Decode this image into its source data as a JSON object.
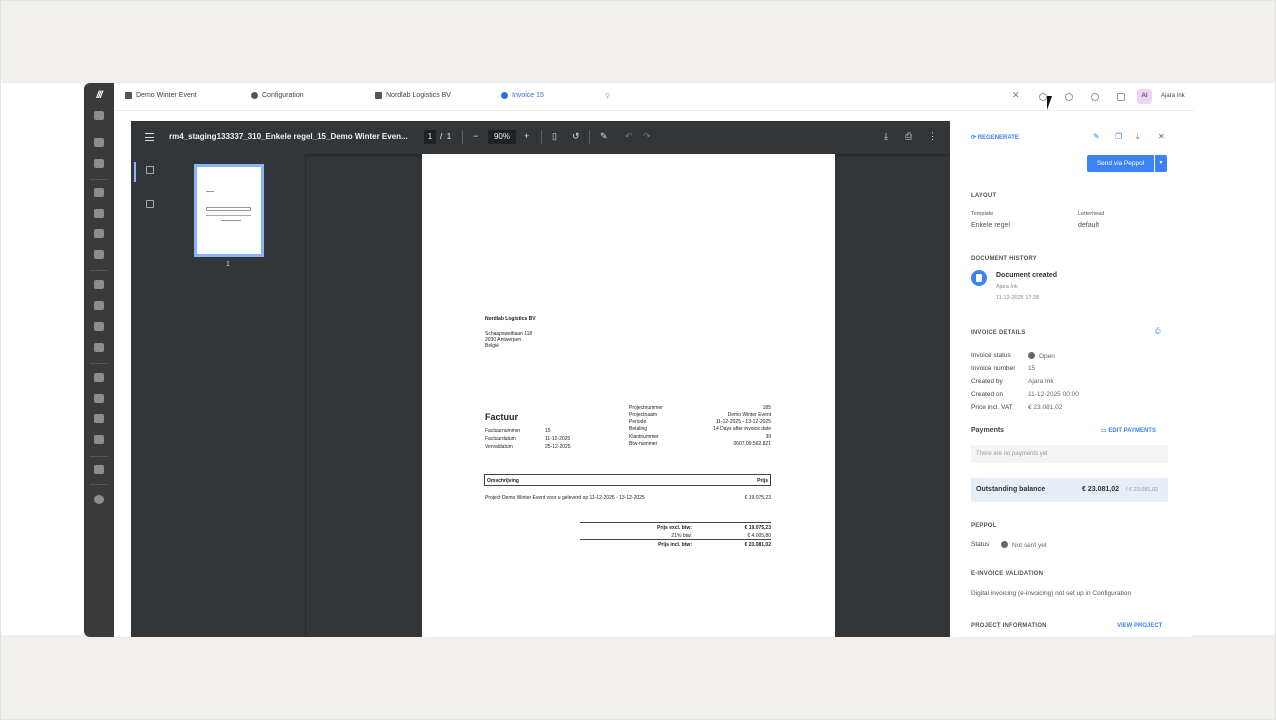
{
  "tabs": [
    {
      "label": "Demo Winter Event",
      "icon": "calendar-icon"
    },
    {
      "label": "Configuration",
      "icon": "gear-icon"
    },
    {
      "label": "Nordlab Logistics BV",
      "icon": "building-icon"
    },
    {
      "label": "Invoice 15",
      "icon": "invoice-icon"
    }
  ],
  "user": {
    "initials": "AI",
    "name": "Ajara Ink"
  },
  "viewer": {
    "filename": "rm4_staging133337_310_Enkele regel_15_Demo Winter Even...",
    "page": "1",
    "page_sep": "/",
    "page_total": "1",
    "zoom": "90%",
    "thumb_page": "1"
  },
  "doc": {
    "company": "Nordlab Logistics BV",
    "addr1": "Schaapsweitlaan 118",
    "addr2": "2030 Antwerpen",
    "addr3": "België",
    "heading": "Factuur",
    "left_rows": [
      {
        "k": "Factuurnummer",
        "v": "15"
      },
      {
        "k": "Factuurdatum",
        "v": "11-12-2025"
      },
      {
        "k": "Vervaldatum",
        "v": "25-12-2025"
      }
    ],
    "right_rows": [
      {
        "k": "Projectnummer",
        "v": "185"
      },
      {
        "k": "Projectnaam",
        "v": "Demo Winter Event"
      },
      {
        "k": "Periode",
        "v": "11-12-2025 - 13-12-2025"
      },
      {
        "k": "Betaling",
        "v": "14 Days after invoice date"
      },
      {
        "k": "Klantnummer",
        "v": "39"
      },
      {
        "k": "Btw-nummer",
        "v": "0607.09.562.821"
      }
    ],
    "col_desc": "Omschrijving",
    "col_price": "Prijs",
    "line_desc": "Project Demo Winter Event voor u geleverd op 11-12-2025 - 13-12-2025",
    "line_amount": "€ 19.075,23",
    "tot_excl_label": "Prijs excl. btw:",
    "tot_excl": "€ 19.075,23",
    "vat_label": "21% btw:",
    "vat": "€ 4.005,80",
    "tot_incl_label": "Prijs incl. btw:",
    "tot_incl": "€ 23.081,02"
  },
  "panel": {
    "regenerate": "REGENERATE",
    "send": "Send via Peppol",
    "layout_title": "LAYOUT",
    "template_label": "Template",
    "template_value": "Enkele regel",
    "letterhead_label": "Letterhead",
    "letterhead_value": "default",
    "history_title": "DOCUMENT HISTORY",
    "history_event": "Document created",
    "history_user": "Ajara Ink",
    "history_time": "11-12-2025 17:38",
    "details_title": "INVOICE DETAILS",
    "status_label": "Invoice status",
    "status_value": "Open",
    "number_label": "Invoice number",
    "number_value": "15",
    "created_by_label": "Created by",
    "created_by_value": "Ajara Ink",
    "created_on_label": "Created on",
    "created_on_value": "11-12-2025 00:00",
    "price_label": "Price incl. VAT",
    "price_value": "€ 23.081,02",
    "payments_label": "Payments",
    "edit_payments": "EDIT PAYMENTS",
    "no_payments": "There are no payments yet",
    "outstanding_label": "Outstanding balance",
    "outstanding_value": "€ 23.081,02",
    "outstanding_total": "/ € 23.081,02",
    "peppol_title": "PEPPOL",
    "peppol_status_label": "Status",
    "peppol_status_value": "Not sent yet",
    "einv_title": "E-INVOICE VALIDATION",
    "einv_text": "Digital invoicing (e-invoicing) not set up in Configuration",
    "project_title": "PROJECT INFORMATION",
    "view_project": "VIEW PROJECT"
  },
  "colors": {
    "accent": "#3b82f6",
    "sidebar": "#3a3a3a",
    "viewer": "#323639"
  }
}
